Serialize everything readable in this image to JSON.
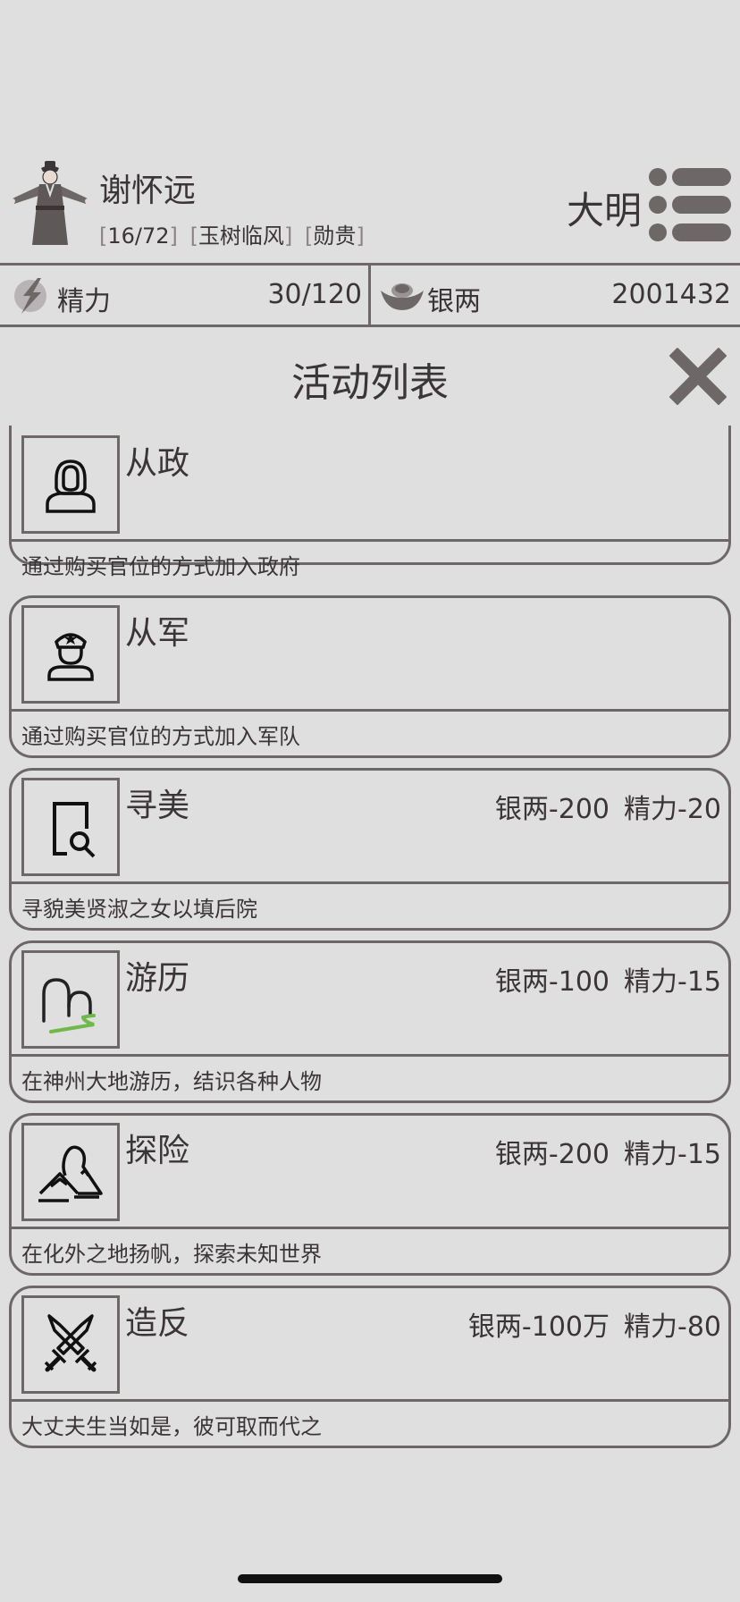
{
  "character": {
    "name": "谢怀远",
    "tags": [
      "16/72",
      "玉树临风",
      "勋贵"
    ],
    "dynasty": "大明"
  },
  "stats": {
    "energy": {
      "label": "精力",
      "value": "30/120",
      "icon": "lightning-icon"
    },
    "silver": {
      "label": "银两",
      "value": "2001432",
      "icon": "silver-ingot-icon"
    }
  },
  "panel": {
    "title": "活动列表"
  },
  "activities": [
    {
      "name": "从政",
      "cost_silver": "",
      "cost_energy": "",
      "desc": "通过购买官位的方式加入政府",
      "icon": "official-icon"
    },
    {
      "name": "从军",
      "cost_silver": "",
      "cost_energy": "",
      "desc": "通过购买官位的方式加入军队",
      "icon": "soldier-icon"
    },
    {
      "name": "寻美",
      "cost_silver": "银两-200",
      "cost_energy": "精力-20",
      "desc": "寻貌美贤淑之女以填后院",
      "icon": "search-document-icon"
    },
    {
      "name": "游历",
      "cost_silver": "银两-100",
      "cost_energy": "精力-15",
      "desc": "在神州大地游历，结识各种人物",
      "icon": "travel-hills-icon"
    },
    {
      "name": "探险",
      "cost_silver": "银两-200",
      "cost_energy": "精力-15",
      "desc": "在化外之地扬帆，探索未知世界",
      "icon": "mountain-icon"
    },
    {
      "name": "造反",
      "cost_silver": "银两-100万",
      "cost_energy": "精力-80",
      "desc": "大丈夫生当如是，彼可取而代之",
      "icon": "crossed-swords-icon"
    }
  ],
  "colors": {
    "background": "#dfdfdf",
    "border": "#6e6768",
    "text": "#3a3536",
    "accent_green": "#6fb84a"
  }
}
